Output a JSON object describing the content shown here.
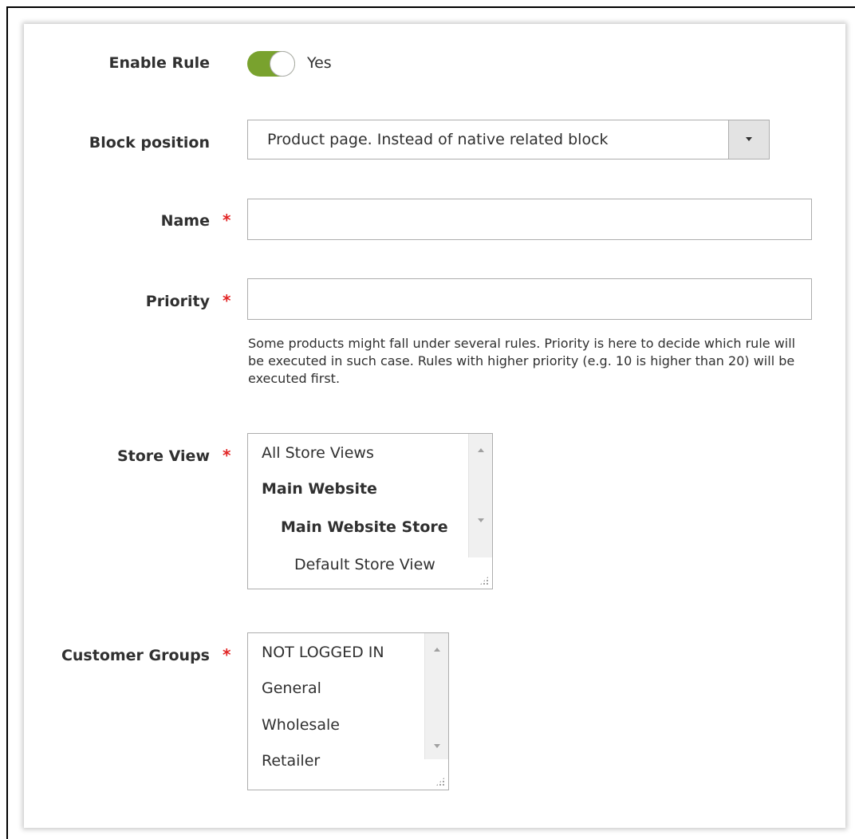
{
  "form": {
    "enable_rule": {
      "label": "Enable Rule",
      "value": "Yes",
      "enabled": true
    },
    "block_position": {
      "label": "Block position",
      "selected": "Product page. Instead of native related block"
    },
    "name": {
      "label": "Name",
      "required": "*",
      "value": ""
    },
    "priority": {
      "label": "Priority",
      "required": "*",
      "value": "",
      "note": "Some products might fall under several rules. Priority is here to decide which rule will be executed in such case. Rules with higher priority (e.g. 10 is higher than 20) will be executed first."
    },
    "store_view": {
      "label": "Store View",
      "required": "*",
      "options": [
        "All Store Views",
        "Main Website",
        "Main Website Store",
        "Default Store View"
      ]
    },
    "customer_groups": {
      "label": "Customer Groups",
      "required": "*",
      "options": [
        "NOT LOGGED IN",
        "General",
        "Wholesale",
        "Retailer"
      ]
    }
  },
  "colors": {
    "toggle_on": "#79a22e",
    "required": "#e22626",
    "border": "#adadad"
  },
  "icons": {
    "select_arrow": "chevron-down-icon",
    "scroll_up": "scroll-up-icon",
    "scroll_down": "scroll-down-icon",
    "resize": "resize-grip-icon"
  }
}
